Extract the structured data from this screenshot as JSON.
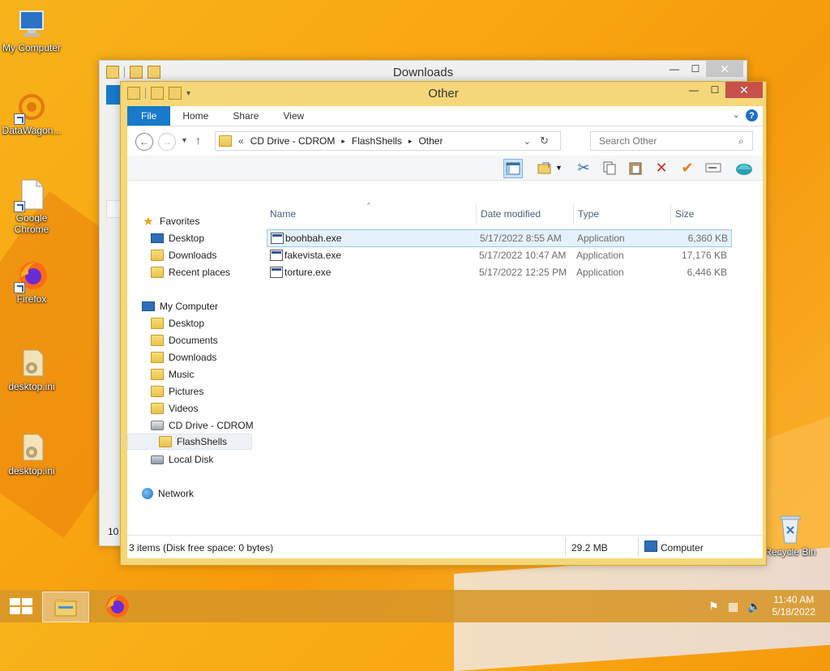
{
  "desktop": {
    "icons": [
      {
        "label": "My Computer"
      },
      {
        "label": "DataWagon..."
      },
      {
        "label": "Google Chrome"
      },
      {
        "label": "Firefox"
      },
      {
        "label": "desktop.ini"
      },
      {
        "label": "desktop.ini"
      },
      {
        "label": "Recycle Bin"
      }
    ]
  },
  "back_window": {
    "title": "Downloads",
    "status_fragment": "10"
  },
  "window": {
    "title": "Other",
    "ribbon": {
      "tabs": [
        "File",
        "Home",
        "Share",
        "View"
      ]
    },
    "address": {
      "prefix": "«",
      "path": [
        "CD Drive - CDROM",
        "FlashShells",
        "Other"
      ]
    },
    "search": {
      "placeholder": "Search Other"
    },
    "nav": {
      "favorites": {
        "label": "Favorites",
        "items": [
          "Desktop",
          "Downloads",
          "Recent places"
        ]
      },
      "computer": {
        "label": "My Computer",
        "items": [
          "Desktop",
          "Documents",
          "Downloads",
          "Music",
          "Pictures",
          "Videos",
          "CD Drive - CDROM",
          "FlashShells",
          "Local Disk"
        ]
      },
      "network": {
        "label": "Network"
      }
    },
    "columns": {
      "name": "Name",
      "date": "Date modified",
      "type": "Type",
      "size": "Size"
    },
    "files": [
      {
        "name": "boohbah.exe",
        "date": "5/17/2022 8:55 AM",
        "type": "Application",
        "size": "6,360 KB"
      },
      {
        "name": "fakevista.exe",
        "date": "5/17/2022 10:47 AM",
        "type": "Application",
        "size": "17,176 KB"
      },
      {
        "name": "torture.exe",
        "date": "5/17/2022 12:25 PM",
        "type": "Application",
        "size": "6,446 KB"
      }
    ],
    "status": {
      "items": "3 items (Disk free space: 0 bytes)",
      "size": "29.2 MB",
      "location": "Computer"
    }
  },
  "taskbar": {
    "time": "11:40 AM",
    "date": "5/18/2022"
  },
  "colors": {
    "accent": "#1979ca",
    "titlebar": "#f5d779",
    "close": "#c7504b",
    "selection": "#e6f2fb"
  }
}
